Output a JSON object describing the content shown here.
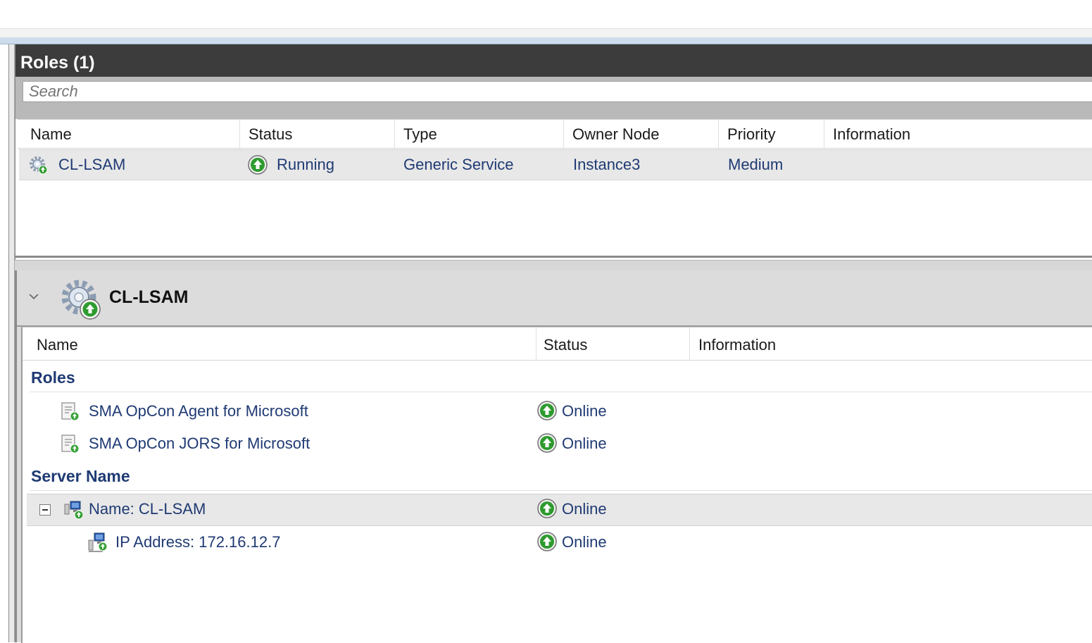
{
  "roles_pane": {
    "title": "Roles (1)",
    "search_placeholder": "Search",
    "columns": [
      "Name",
      "Status",
      "Type",
      "Owner Node",
      "Priority",
      "Information"
    ],
    "rows": [
      {
        "name": "CL-LSAM",
        "status": "Running",
        "type": "Generic Service",
        "owner_node": "Instance3",
        "priority": "Medium",
        "information": "",
        "icon": "gear-role-icon",
        "status_icon": "up-arrow-icon"
      }
    ]
  },
  "detail_pane": {
    "title": "CL-LSAM",
    "columns": [
      "Name",
      "Status",
      "Information"
    ],
    "groups": [
      {
        "label": "Roles",
        "items": [
          {
            "name": "SMA OpCon Agent for Microsoft",
            "status": "Online",
            "icon": "service-icon"
          },
          {
            "name": "SMA OpCon JORS for Microsoft",
            "status": "Online",
            "icon": "service-icon"
          }
        ]
      },
      {
        "label": "Server Name",
        "items": [
          {
            "name": "Name: CL-LSAM",
            "status": "Online",
            "icon": "network-name-icon",
            "expanded": true
          },
          {
            "name": "IP Address: 172.16.12.7",
            "status": "Online",
            "icon": "ip-address-icon"
          }
        ]
      }
    ]
  },
  "colors": {
    "header_dark": "#3c3c3c",
    "link_text": "#1f3a73",
    "status_green": "#2e9b2e",
    "selected_row": "#e8e8e8"
  }
}
